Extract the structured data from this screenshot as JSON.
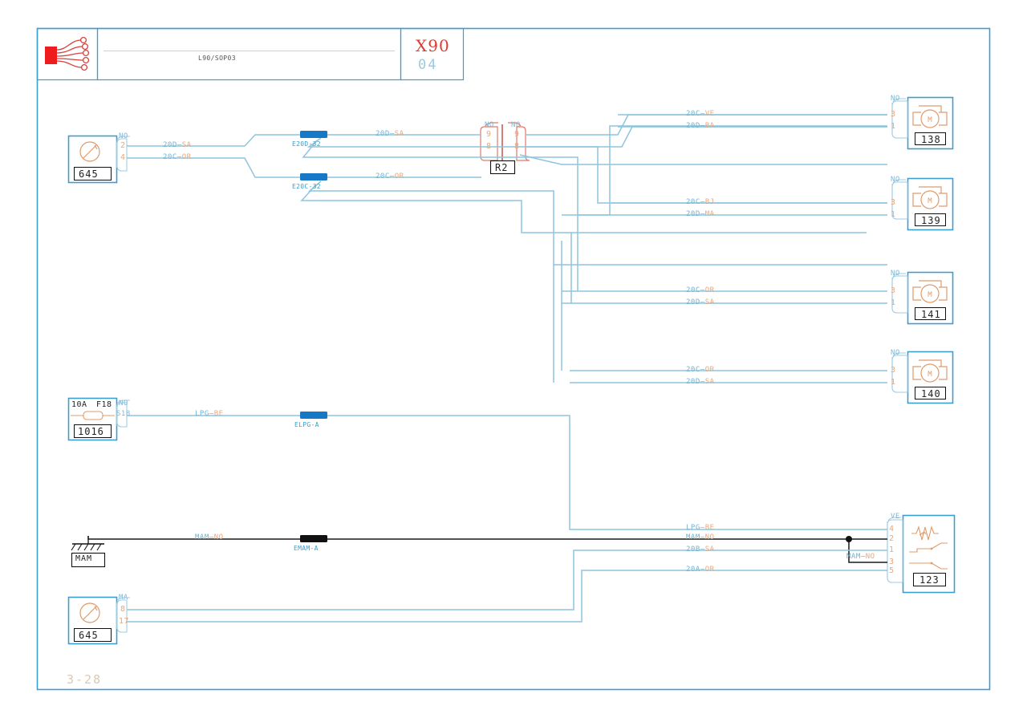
{
  "page": {
    "sheet_code": "X90",
    "sheet_sub": "04",
    "title_center": "L90/SOP03",
    "page_number": "3-28",
    "frame_color": "#3a9fd0",
    "wire_color": "#8ec5de",
    "wire_color_black": "#1a1a1a",
    "splice_color": "#1878c8",
    "splice_color_black": "#111111",
    "device_color": "#3a9fd0",
    "symbol_color": "#e09b6b",
    "connector_color": "#e07a6b",
    "label_blue": "#6fb3d2",
    "label_orange": "#e8a87c"
  },
  "devices": [
    {
      "id": "645-top",
      "number": "645",
      "group": "NO",
      "pins": [
        "2",
        "4"
      ]
    },
    {
      "id": "138",
      "number": "138",
      "group": "NO",
      "pins": [
        "3",
        "1"
      ]
    },
    {
      "id": "139",
      "number": "139",
      "group": "NO",
      "pins": [
        "3",
        "1"
      ]
    },
    {
      "id": "141",
      "number": "141",
      "group": "NO",
      "pins": [
        "3",
        "1"
      ]
    },
    {
      "id": "140",
      "number": "140",
      "group": "NO",
      "pins": [
        "3",
        "1"
      ]
    },
    {
      "id": "1016",
      "number": "1016",
      "rating": "10A",
      "fuse_id": "F18",
      "group": "NO",
      "pin_code": "S18"
    },
    {
      "id": "123",
      "number": "123",
      "group": "VE",
      "pins": [
        "4",
        "2",
        "1",
        "3",
        "5"
      ]
    },
    {
      "id": "645-bottom",
      "number": "645",
      "group": "MA",
      "pins": [
        "8",
        "17"
      ]
    }
  ],
  "connector_r2": {
    "label": "R2",
    "left_group": "NO",
    "right_group": "NO",
    "left_pins": [
      "9",
      "8"
    ],
    "right_pins": [
      "9",
      "8"
    ]
  },
  "ground": {
    "label": "MAM"
  },
  "splices": [
    {
      "name": "E20D-32",
      "color": "blue"
    },
    {
      "name": "E20C-32",
      "color": "blue"
    },
    {
      "name": "ELPG-A",
      "color": "blue"
    },
    {
      "name": "EMAM-A",
      "color": "black"
    }
  ],
  "wire_labels": [
    {
      "code": "20D",
      "color_code": "SA"
    },
    {
      "code": "20C",
      "color_code": "OR"
    },
    {
      "code": "20D",
      "color_code": "SA"
    },
    {
      "code": "20C",
      "color_code": "OR"
    },
    {
      "code": "20C",
      "color_code": "VE"
    },
    {
      "code": "20D",
      "color_code": "BA"
    },
    {
      "code": "20C",
      "color_code": "BJ"
    },
    {
      "code": "20D",
      "color_code": "MA"
    },
    {
      "code": "20C",
      "color_code": "OR"
    },
    {
      "code": "20D",
      "color_code": "SA"
    },
    {
      "code": "20C",
      "color_code": "OR"
    },
    {
      "code": "20D",
      "color_code": "SA"
    },
    {
      "code": "LPG",
      "color_code": "BE"
    },
    {
      "code": "MAM",
      "color_code": "NO"
    },
    {
      "code": "LPG",
      "color_code": "BE"
    },
    {
      "code": "MAM",
      "color_code": "NO"
    },
    {
      "code": "20B",
      "color_code": "SA"
    },
    {
      "code": "20A",
      "color_code": "OR"
    },
    {
      "code": "MAM",
      "color_code": "NO"
    }
  ]
}
